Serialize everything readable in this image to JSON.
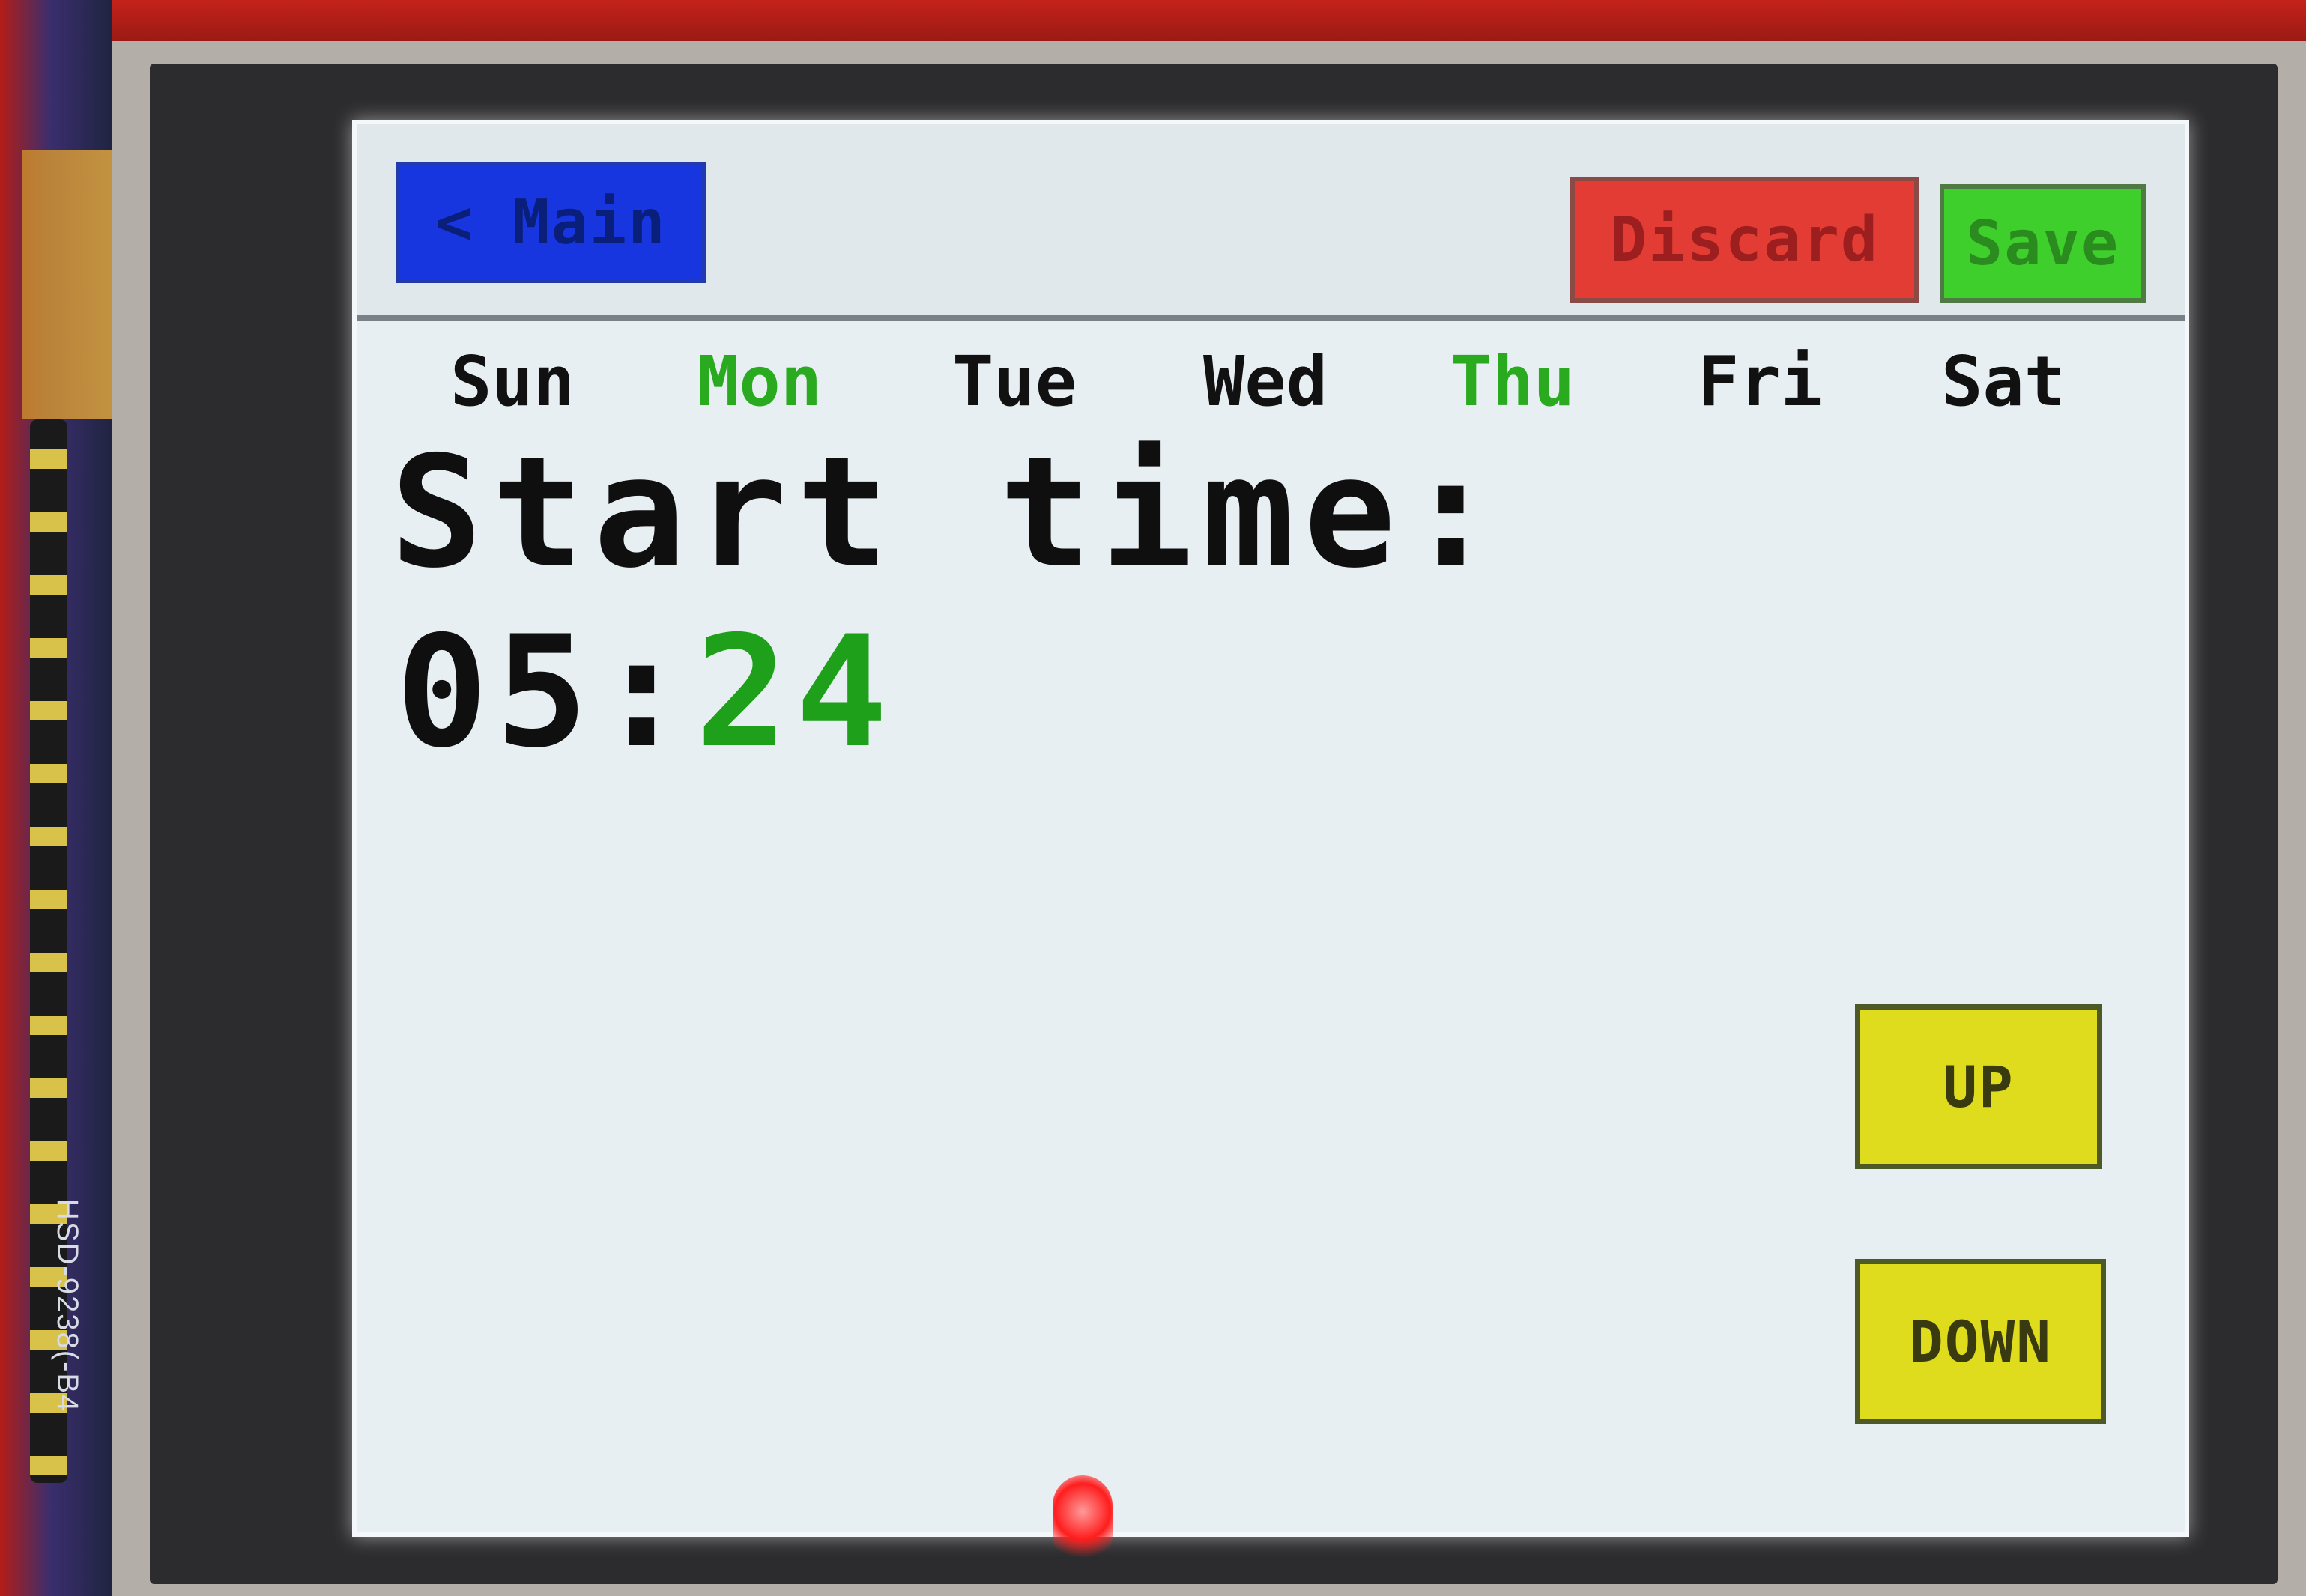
{
  "header": {
    "back_label": "< Main",
    "discard_label": "Discard",
    "save_label": "Save"
  },
  "days": [
    {
      "label": "Sun",
      "selected": false
    },
    {
      "label": "Mon",
      "selected": true
    },
    {
      "label": "Tue",
      "selected": false
    },
    {
      "label": "Wed",
      "selected": false
    },
    {
      "label": "Thu",
      "selected": true
    },
    {
      "label": "Fri",
      "selected": false
    },
    {
      "label": "Sat",
      "selected": false
    }
  ],
  "start_time": {
    "label": "Start time:",
    "hours": "05",
    "separator": ":",
    "minutes": "24"
  },
  "controls": {
    "up_label": "UP",
    "down_label": "DOWN"
  },
  "board": {
    "silkscreen": "HSD-9238(-B4"
  },
  "colors": {
    "main_button": "#1836e0",
    "discard_button": "#e23c34",
    "save_button": "#3fcf2c",
    "updown_buttons": "#dedc1c",
    "selected_day": "#2aaa1f",
    "screen_background": "#e8eff3"
  }
}
